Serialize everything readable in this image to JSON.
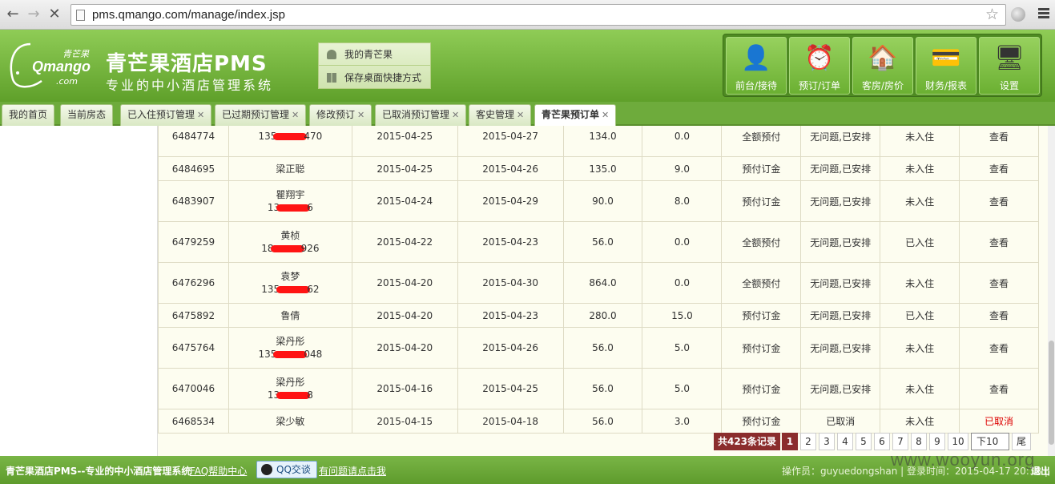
{
  "browser": {
    "url": "pms.qmango.com/manage/index.jsp"
  },
  "header": {
    "logo_cn": "青芒果",
    "logo_en": "Qmango",
    "logo_com": ".com",
    "title": "青芒果酒店PMS",
    "subtitle": "专业的中小酒店管理系统",
    "quick_links": [
      "我的青芒果",
      "保存桌面快捷方式"
    ],
    "toolbar": [
      "前台/接待",
      "预订/订单",
      "客房/房价",
      "财务/报表",
      "设置"
    ]
  },
  "tabs": [
    {
      "label": "我的首页",
      "closable": false
    },
    {
      "label": "当前房态",
      "closable": false
    },
    {
      "label": "已入住预订管理",
      "closable": true
    },
    {
      "label": "已过期预订管理",
      "closable": true
    },
    {
      "label": "修改预订",
      "closable": true
    },
    {
      "label": "已取消预订管理",
      "closable": true
    },
    {
      "label": "客史管理",
      "closable": true
    },
    {
      "label": "青芒果预订单",
      "closable": true,
      "active": true
    }
  ],
  "orders": [
    {
      "id": "6484774",
      "name": "",
      "phone_a": "135",
      "phone_b": "470",
      "checkin": "2015-04-25",
      "checkout": "2015-04-27",
      "amount": "134.0",
      "paid": "0.0",
      "pay_type": "全额预付",
      "status": "无问题,已安排",
      "stay": "未入住",
      "action": "查看",
      "tall": true
    },
    {
      "id": "6484695",
      "name": "梁正聪",
      "phone_a": "",
      "phone_b": "",
      "checkin": "2015-04-25",
      "checkout": "2015-04-26",
      "amount": "135.0",
      "paid": "9.0",
      "pay_type": "预付订金",
      "status": "无问题,已安排",
      "stay": "未入住",
      "action": "查看",
      "tall": false
    },
    {
      "id": "6483907",
      "name": "瞿翔宇",
      "phone_a": "13",
      "phone_b": "6",
      "checkin": "2015-04-24",
      "checkout": "2015-04-29",
      "amount": "90.0",
      "paid": "8.0",
      "pay_type": "预付订金",
      "status": "无问题,已安排",
      "stay": "未入住",
      "action": "查看",
      "tall": true
    },
    {
      "id": "6479259",
      "name": "黄桢",
      "phone_a": "18",
      "phone_b": "926",
      "checkin": "2015-04-22",
      "checkout": "2015-04-23",
      "amount": "56.0",
      "paid": "0.0",
      "pay_type": "全额预付",
      "status": "无问题,已安排",
      "stay": "已入住",
      "action": "查看",
      "tall": true
    },
    {
      "id": "6476296",
      "name": "袁梦",
      "phone_a": "135",
      "phone_b": "62",
      "checkin": "2015-04-20",
      "checkout": "2015-04-30",
      "amount": "864.0",
      "paid": "0.0",
      "pay_type": "全额预付",
      "status": "无问题,已安排",
      "stay": "未入住",
      "action": "查看",
      "tall": true
    },
    {
      "id": "6475892",
      "name": "鲁倩",
      "phone_a": "",
      "phone_b": "",
      "checkin": "2015-04-20",
      "checkout": "2015-04-23",
      "amount": "280.0",
      "paid": "15.0",
      "pay_type": "预付订金",
      "status": "无问题,已安排",
      "stay": "已入住",
      "action": "查看",
      "tall": false
    },
    {
      "id": "6475764",
      "name": "梁丹彤",
      "phone_a": "135",
      "phone_b": "048",
      "checkin": "2015-04-20",
      "checkout": "2015-04-26",
      "amount": "56.0",
      "paid": "5.0",
      "pay_type": "预付订金",
      "status": "无问题,已安排",
      "stay": "未入住",
      "action": "查看",
      "tall": true
    },
    {
      "id": "6470046",
      "name": "梁丹彤",
      "phone_a": "13",
      "phone_b": "8",
      "checkin": "2015-04-16",
      "checkout": "2015-04-25",
      "amount": "56.0",
      "paid": "5.0",
      "pay_type": "预付订金",
      "status": "无问题,已安排",
      "stay": "未入住",
      "action": "查看",
      "tall": true
    },
    {
      "id": "6468534",
      "name": "梁少敏",
      "phone_a": "",
      "phone_b": "",
      "checkin": "2015-04-15",
      "checkout": "2015-04-18",
      "amount": "56.0",
      "paid": "3.0",
      "pay_type": "预付订金",
      "status": "已取消",
      "stay": "未入住",
      "action": "已取消",
      "tall": false
    }
  ],
  "pager": {
    "total": "共423条记录",
    "pages": [
      "1",
      "2",
      "3",
      "4",
      "5",
      "6",
      "7",
      "8",
      "9",
      "10"
    ],
    "current": "1",
    "next10": "下10",
    "last": "尾"
  },
  "footer": {
    "title": "青芒果酒店PMS--专业的中小酒店管理系统",
    "faq": "FAQ帮助中心",
    "qq": "QQ交谈",
    "help": "有问题请点击我",
    "operator": "操作员：guyuedongshan | 登录时间：2015-04-17 20:18 |",
    "logout": "退出"
  },
  "watermark": "www.wooyun.org",
  "colors": {
    "header_green": "#6eab3c",
    "pager_red": "#8b2d2d",
    "cancel_red": "#dd0000"
  }
}
